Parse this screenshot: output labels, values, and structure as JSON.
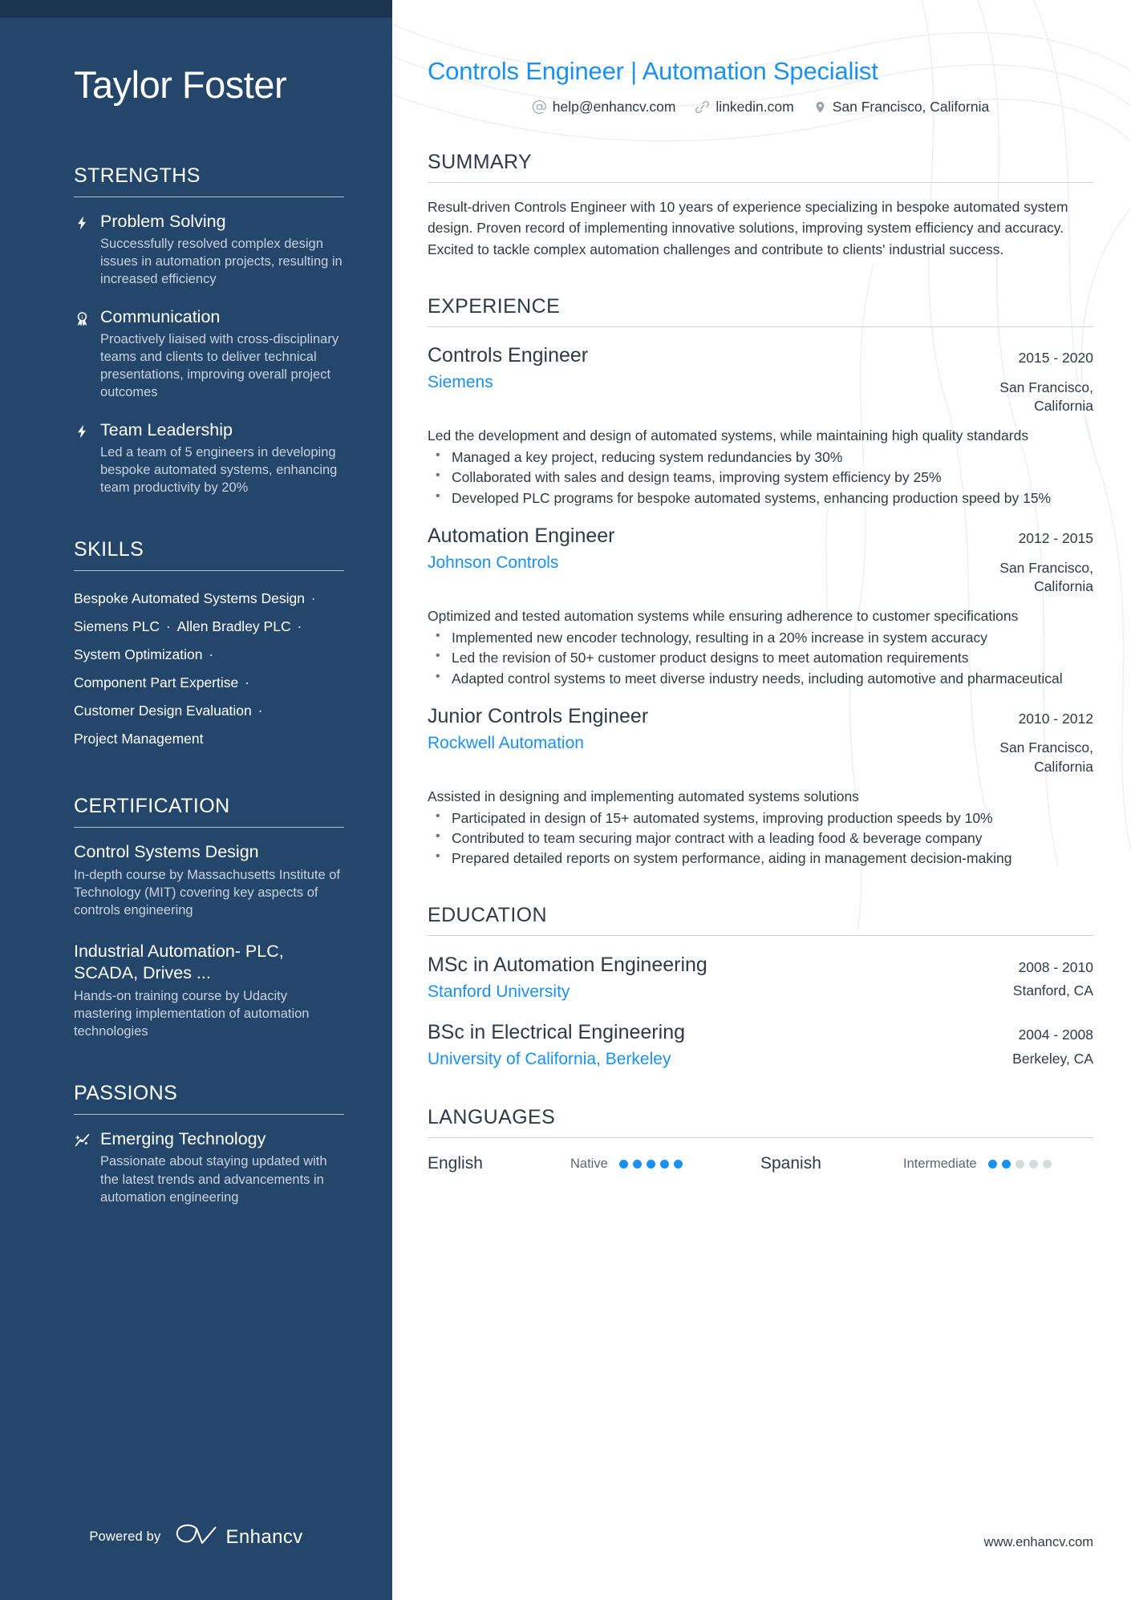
{
  "theme": {
    "sidebar_bg": "#24466a",
    "sidebar_topbar": "#1b3450",
    "accent": "#1a91f0",
    "text_dark": "#2e3a46",
    "muted": "#c7d2dd"
  },
  "sidebar": {
    "full_name": "Taylor Foster",
    "sections": {
      "strengths": {
        "heading": "STRENGTHS",
        "items": [
          {
            "icon": "lightning-bolt-icon",
            "title": "Problem Solving",
            "desc": "Successfully resolved complex design issues in automation projects, resulting in increased efficiency"
          },
          {
            "icon": "award-ribbon-icon",
            "title": "Communication",
            "desc": "Proactively liaised with cross-disciplinary teams and clients to deliver technical presentations, improving overall project outcomes"
          },
          {
            "icon": "lightning-bolt-icon",
            "title": "Team Leadership",
            "desc": "Led a team of 5 engineers in developing bespoke automated systems, enhancing team productivity by 20%"
          }
        ]
      },
      "skills": {
        "heading": "SKILLS",
        "separator": "·",
        "items": [
          "Bespoke Automated Systems Design",
          "Siemens PLC",
          "Allen Bradley PLC",
          "System Optimization",
          "Component Part Expertise",
          "Customer Design Evaluation",
          "Project Management"
        ]
      },
      "certification": {
        "heading": "CERTIFICATION",
        "items": [
          {
            "title": "Control Systems Design",
            "desc": "In-depth course by Massachusetts Institute of Technology (MIT) covering key aspects of controls engineering"
          },
          {
            "title": "Industrial Automation- PLC, SCADA, Drives ...",
            "desc": "Hands-on training course by Udacity mastering implementation of automation technologies"
          }
        ]
      },
      "passions": {
        "heading": "PASSIONS",
        "items": [
          {
            "icon": "trending-spark-icon",
            "title": "Emerging Technology",
            "desc": "Passionate about staying updated with the latest trends and advancements in automation engineering"
          }
        ]
      }
    },
    "footer": {
      "powered_by": "Powered by",
      "brand": "Enhancv",
      "logo_icon": "enhancv-logo-icon"
    }
  },
  "main": {
    "headline": "Controls Engineer | Automation Specialist",
    "contacts": [
      {
        "icon": "at-sign-icon",
        "text": "help@enhancv.com"
      },
      {
        "icon": "link-icon",
        "text": "linkedin.com"
      },
      {
        "icon": "location-pin-icon",
        "text": "San Francisco, California"
      }
    ],
    "summary": {
      "heading": "SUMMARY",
      "text": "Result-driven Controls Engineer with 10 years of experience specializing in bespoke automated system design. Proven record of implementing innovative solutions, improving system efficiency and accuracy. Excited to tackle complex automation challenges and contribute to clients' industrial success."
    },
    "experience": {
      "heading": "EXPERIENCE",
      "entries": [
        {
          "title": "Controls Engineer",
          "org": "Siemens",
          "date": "2015 - 2020",
          "location": "San Francisco, California",
          "desc": "Led the development and design of automated systems, while maintaining high quality standards",
          "bullets": [
            "Managed a key project, reducing system redundancies by 30%",
            "Collaborated with sales and design teams, improving system efficiency by 25%",
            "Developed PLC programs for bespoke automated systems, enhancing production speed by 15%"
          ]
        },
        {
          "title": "Automation Engineer",
          "org": "Johnson Controls",
          "date": "2012 - 2015",
          "location": "San Francisco, California",
          "desc": "Optimized and tested automation systems while ensuring adherence to customer specifications",
          "bullets": [
            "Implemented new encoder technology, resulting in a 20% increase in system accuracy",
            "Led the revision of 50+ customer product designs to meet automation requirements",
            "Adapted control systems to meet diverse industry needs, including automotive and pharmaceutical"
          ]
        },
        {
          "title": "Junior Controls Engineer",
          "org": "Rockwell Automation",
          "date": "2010 - 2012",
          "location": "San Francisco, California",
          "desc": "Assisted in designing and implementing automated systems solutions",
          "bullets": [
            "Participated in design of 15+ automated systems, improving production speeds by 10%",
            "Contributed to team securing major contract with a leading food & beverage company",
            "Prepared detailed reports on system performance, aiding in management decision-making"
          ]
        }
      ]
    },
    "education": {
      "heading": "EDUCATION",
      "entries": [
        {
          "title": "MSc in Automation Engineering",
          "org": "Stanford University",
          "date": "2008 - 2010",
          "location": "Stanford, CA"
        },
        {
          "title": "BSc in Electrical Engineering",
          "org": "University of California, Berkeley",
          "date": "2004 - 2008",
          "location": "Berkeley, CA"
        }
      ]
    },
    "languages": {
      "heading": "LANGUAGES",
      "items": [
        {
          "name": "English",
          "level": "Native",
          "filled": 5,
          "total": 5
        },
        {
          "name": "Spanish",
          "level": "Intermediate",
          "filled": 2,
          "total": 5
        }
      ]
    },
    "site_url": "www.enhancv.com"
  }
}
